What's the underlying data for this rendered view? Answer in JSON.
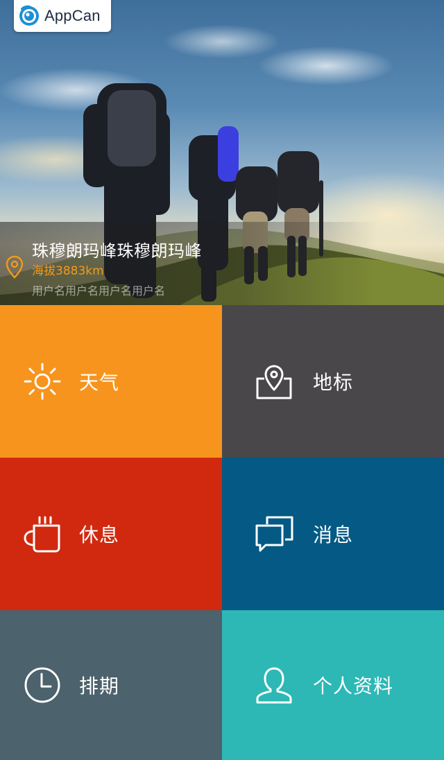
{
  "app": {
    "logo_text": "AppCan"
  },
  "hero": {
    "title": "珠穆朗玛峰珠穆朗玛峰",
    "altitude": "海拔3883km",
    "user": "用户名用户名用户名用户名"
  },
  "tiles": [
    {
      "label": "天气",
      "icon": "sun-icon",
      "color": "#f7941d"
    },
    {
      "label": "地标",
      "icon": "map-pin-icon",
      "color": "#4a474b"
    },
    {
      "label": "休息",
      "icon": "coffee-cup-icon",
      "color": "#d1290f"
    },
    {
      "label": "消息",
      "icon": "message-icon",
      "color": "#045a84"
    },
    {
      "label": "排期",
      "icon": "clock-icon",
      "color": "#4c626c"
    },
    {
      "label": "个人资料",
      "icon": "user-icon",
      "color": "#2db8b5"
    }
  ],
  "colors": {
    "accent_orange": "#f39a1a"
  }
}
